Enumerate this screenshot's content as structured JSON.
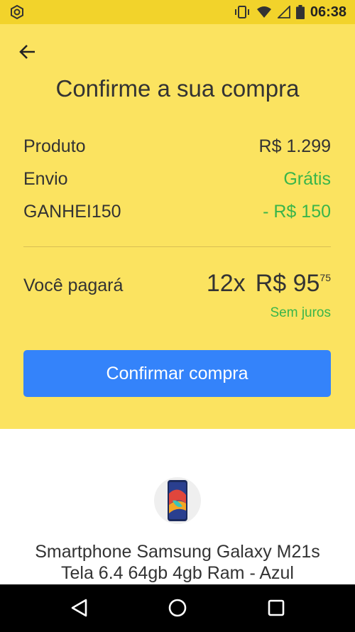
{
  "status_bar": {
    "time": "06:38",
    "icons": [
      "app-notification-icon",
      "vibrate-icon",
      "wifi-icon",
      "signal-icon",
      "battery-icon"
    ]
  },
  "header": {
    "title": "Confirme a sua compra"
  },
  "summary": {
    "rows": [
      {
        "label": "Produto",
        "value": "R$ 1.299"
      },
      {
        "label": "Envio",
        "value": "Grátis"
      },
      {
        "label": "GANHEI150",
        "value": "- R$ 150"
      }
    ]
  },
  "payment": {
    "label": "Você pagará",
    "installments": "12x",
    "amount": "R$ 95",
    "cents": "75",
    "note": "Sem juros"
  },
  "actions": {
    "confirm_label": "Confirmar compra"
  },
  "product": {
    "name_line1": "Smartphone Samsung Galaxy M21s",
    "name_line2": "Tela 6.4 64gb 4gb Ram - Azul"
  },
  "colors": {
    "yellow": "#fbe360",
    "status_yellow": "#f2d32b",
    "blue": "#3483fa",
    "green": "#39b54a"
  },
  "nav_bar": {
    "icons": [
      "back-triangle-icon",
      "home-circle-icon",
      "recents-square-icon"
    ]
  }
}
